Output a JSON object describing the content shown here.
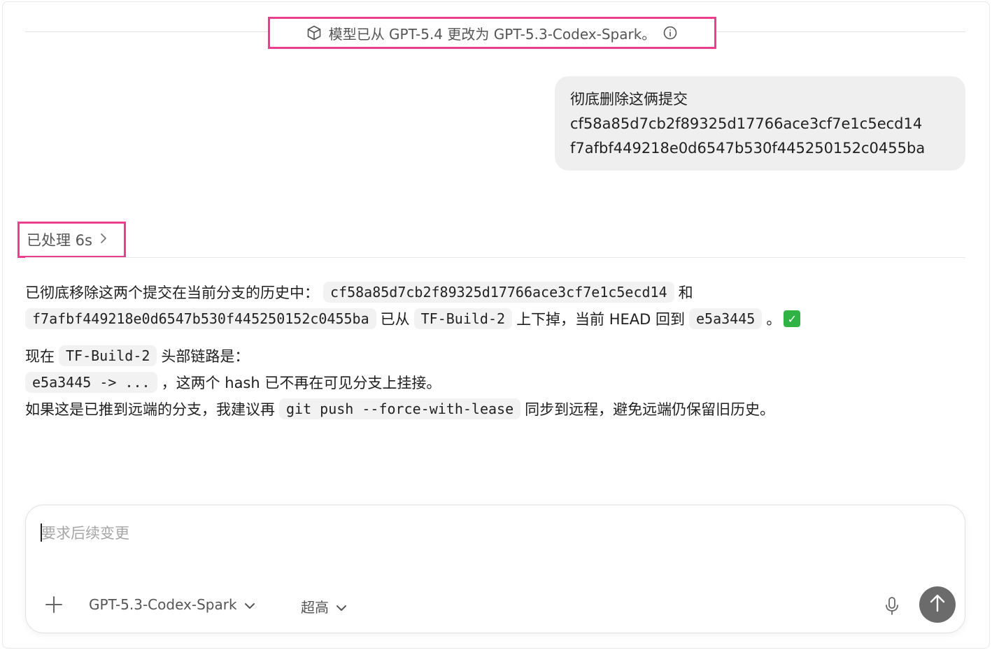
{
  "notice": {
    "text": "模型已从 GPT-5.4 更改为 GPT-5.3-Codex-Spark。",
    "icon": "cube-icon",
    "info_icon": "info-icon"
  },
  "user_message": {
    "lines": [
      "彻底删除这俩提交",
      "cf58a85d7cb2f89325d17766ace3cf7e1c5ecd14",
      "f7afbf449218e0d6547b530f445250152c0455ba"
    ]
  },
  "processed": {
    "label": "已处理 6s",
    "icon": "chevron-right-icon"
  },
  "reply": {
    "p1_a": "已彻底移除这两个提交在当前分支的历史中：",
    "commit1": "cf58a85d7cb2f89325d17766ace3cf7e1c5ecd14",
    "p1_and": "和",
    "commit2": "f7afbf449218e0d6547b530f445250152c0455ba",
    "p1_b": "已从",
    "branch": "TF-Build-2",
    "p1_c": "上下掉，当前 HEAD 回到",
    "head": "e5a3445",
    "p1_d": "。",
    "check_icon": "check-mark-icon",
    "p2_a": "现在",
    "p2_branch": "TF-Build-2",
    "p2_b": "头部链路是：",
    "chain": "e5a3445 -> ...",
    "p3_a": "，这两个 hash 已不再在可见分支上挂接。",
    "p4_a": "如果这是已推到远端的分支，我建议再",
    "cmd": "git push --force-with-lease",
    "p4_b": "同步到远程，避免远端仍保留旧历史。"
  },
  "composer": {
    "placeholder": "要求后续变更",
    "model": "GPT-5.3-Codex-Spark",
    "effort": "超高",
    "add_icon": "plus-icon",
    "dropdown_icon": "chevron-down-icon",
    "mic_icon": "microphone-icon",
    "send_icon": "arrow-up-icon"
  },
  "colors": {
    "highlight": "#ea3f8c",
    "send_button": "#6b6b6b",
    "bubble": "#efefef",
    "check": "#2fb344"
  }
}
